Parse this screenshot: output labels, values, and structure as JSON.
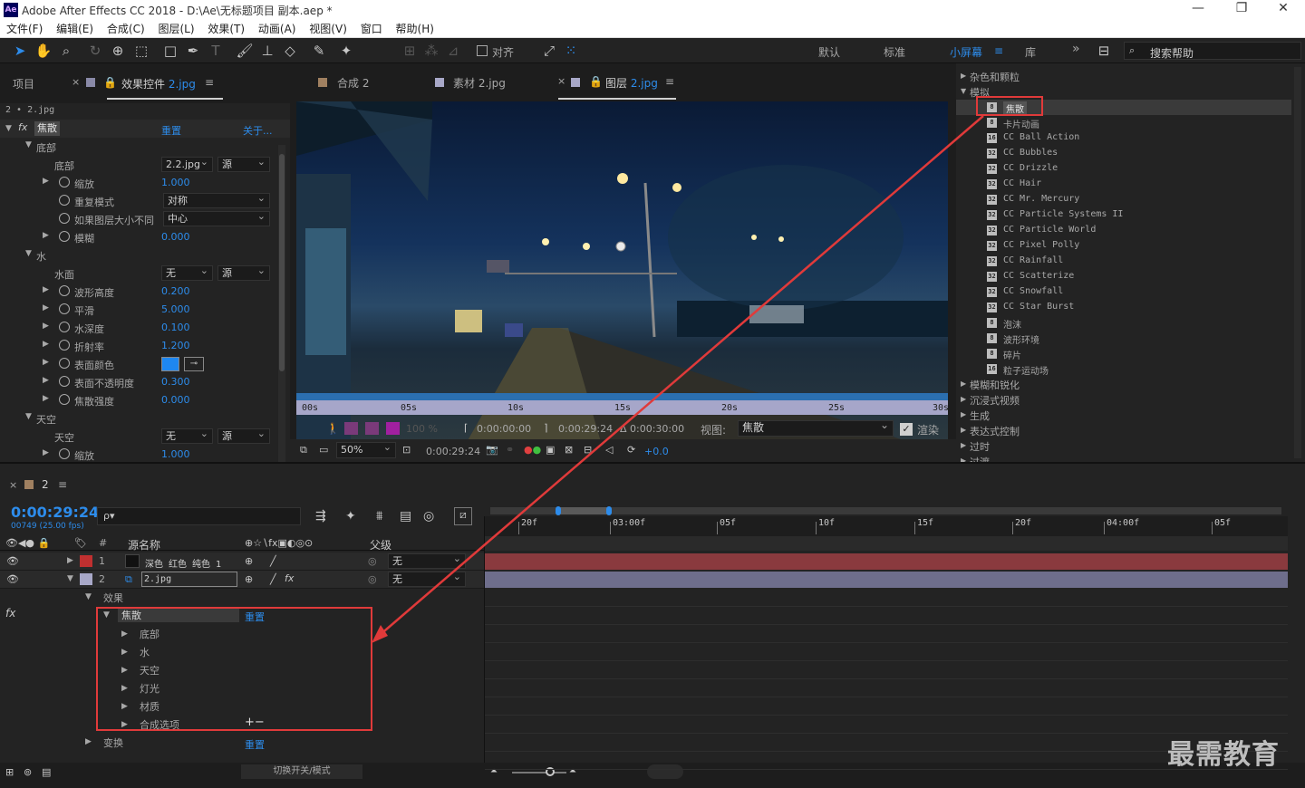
{
  "app": {
    "title": "Adobe After Effects CC 2018 - D:\\Ae\\无标题项目 副本.aep *",
    "logo": "Ae"
  },
  "window_controls": {
    "minimize": "—",
    "restore": "❐",
    "close": "✕"
  },
  "menu": [
    "文件(F)",
    "编辑(E)",
    "合成(C)",
    "图层(L)",
    "效果(T)",
    "动画(A)",
    "视图(V)",
    "窗口",
    "帮助(H)"
  ],
  "toolbar": {
    "snap_label": "对齐",
    "workspaces": [
      "默认",
      "标准",
      "小屏幕",
      "库"
    ],
    "active_workspace": "小屏幕",
    "search_placeholder": "搜索帮助",
    "more": "»"
  },
  "left_panel": {
    "tab_project": "项目",
    "tab_effect": "效果控件",
    "tab_effect_target": "2.jpg",
    "layer_path": "2 • 2.jpg",
    "effect_name": "焦散",
    "reset": "重置",
    "about": "关于...",
    "rows": [
      {
        "t": "group",
        "label": "底部",
        "indent": 1
      },
      {
        "t": "dd2",
        "label": "底部",
        "v1": "2.2.jpg",
        "v2": "源",
        "indent": 2
      },
      {
        "t": "val",
        "label": "缩放",
        "value": "1.000"
      },
      {
        "t": "dd1",
        "label": "重复模式",
        "value": "对称"
      },
      {
        "t": "dd1",
        "label": "如果图层大小不同",
        "value": "中心"
      },
      {
        "t": "val",
        "label": "模糊",
        "value": "0.000"
      },
      {
        "t": "group",
        "label": "水",
        "indent": 1
      },
      {
        "t": "dd2",
        "label": "水面",
        "v1": "无",
        "v2": "源",
        "indent": 2
      },
      {
        "t": "val",
        "label": "波形高度",
        "value": "0.200"
      },
      {
        "t": "val",
        "label": "平滑",
        "value": "5.000"
      },
      {
        "t": "val",
        "label": "水深度",
        "value": "0.100"
      },
      {
        "t": "val",
        "label": "折射率",
        "value": "1.200"
      },
      {
        "t": "color",
        "label": "表面颜色",
        "color": "#1e87f0"
      },
      {
        "t": "val",
        "label": "表面不透明度",
        "value": "0.300"
      },
      {
        "t": "val",
        "label": "焦散强度",
        "value": "0.000"
      },
      {
        "t": "group",
        "label": "天空",
        "indent": 1
      },
      {
        "t": "dd2",
        "label": "天空",
        "v1": "无",
        "v2": "源",
        "indent": 2
      },
      {
        "t": "val",
        "label": "缩放",
        "value": "1.000"
      }
    ]
  },
  "viewer": {
    "tabs": [
      {
        "label": "合成",
        "target": "2",
        "color": "#a08060"
      },
      {
        "label": "素材",
        "target": "2.jpg",
        "color": "#a8a8c8"
      },
      {
        "label": "图层",
        "target": "2.jpg",
        "color": "#a8a8c8",
        "active": true
      }
    ],
    "ruler": [
      "00s",
      "05s",
      "10s",
      "15s",
      "20s",
      "25s",
      "30s"
    ],
    "controls": {
      "opacity": "100 %",
      "in_time": "0:00:00:00",
      "out_time": "0:00:29:24",
      "duration": "Δ 0:00:30:00",
      "view_label": "视图:",
      "view_value": "焦散",
      "render": "渲染"
    },
    "bottom": {
      "zoom": "50%",
      "time": "0:00:29:24",
      "exposure": "+0.0"
    }
  },
  "effects_panel": {
    "items": [
      {
        "t": "cat",
        "label": "杂色和颗粒",
        "open": false
      },
      {
        "t": "cat",
        "label": "模拟",
        "open": true
      },
      {
        "t": "eff",
        "label": "焦散",
        "ic": "8",
        "selected": true
      },
      {
        "t": "eff",
        "label": "卡片动画",
        "ic": "8"
      },
      {
        "t": "eff",
        "label": "CC Ball Action",
        "ic": "16"
      },
      {
        "t": "eff",
        "label": "CC Bubbles",
        "ic": "32"
      },
      {
        "t": "eff",
        "label": "CC Drizzle",
        "ic": "32"
      },
      {
        "t": "eff",
        "label": "CC Hair",
        "ic": "32"
      },
      {
        "t": "eff",
        "label": "CC Mr. Mercury",
        "ic": "32"
      },
      {
        "t": "eff",
        "label": "CC Particle Systems II",
        "ic": "32"
      },
      {
        "t": "eff",
        "label": "CC Particle World",
        "ic": "32"
      },
      {
        "t": "eff",
        "label": "CC Pixel Polly",
        "ic": "32"
      },
      {
        "t": "eff",
        "label": "CC Rainfall",
        "ic": "32"
      },
      {
        "t": "eff",
        "label": "CC Scatterize",
        "ic": "32"
      },
      {
        "t": "eff",
        "label": "CC Snowfall",
        "ic": "32"
      },
      {
        "t": "eff",
        "label": "CC Star Burst",
        "ic": "32"
      },
      {
        "t": "eff",
        "label": "泡沫",
        "ic": "8"
      },
      {
        "t": "eff",
        "label": "波形环境",
        "ic": "8"
      },
      {
        "t": "eff",
        "label": "碎片",
        "ic": "8"
      },
      {
        "t": "eff",
        "label": "粒子运动场",
        "ic": "16"
      },
      {
        "t": "cat",
        "label": "模糊和锐化",
        "open": false
      },
      {
        "t": "cat",
        "label": "沉浸式视频",
        "open": false
      },
      {
        "t": "cat",
        "label": "生成",
        "open": false
      },
      {
        "t": "cat",
        "label": "表达式控制",
        "open": false
      },
      {
        "t": "cat",
        "label": "过时",
        "open": false
      },
      {
        "t": "cat",
        "label": "过渡",
        "open": false
      }
    ]
  },
  "timeline": {
    "tab": "2",
    "timecode": "0:00:29:24",
    "frames": "00749 (25.00 fps)",
    "search_icon": "ρ▾",
    "col_source": "源名称",
    "col_parent": "父级",
    "col_num": "#",
    "ruler": [
      "20f",
      "03:00f",
      "05f",
      "10f",
      "15f",
      "20f",
      "04:00f",
      "05f"
    ],
    "layers": [
      {
        "num": "1",
        "name": "深色 红色 纯色 1",
        "color": "#c03030",
        "parent": "无",
        "bar": "#8a3a3e"
      },
      {
        "num": "2",
        "name": "2.jpg",
        "color": "#a8a8c8",
        "parent": "无",
        "bar": "#6e6e8c"
      }
    ],
    "effects_label": "效果",
    "fx": "fx",
    "effect": "焦散",
    "reset": "重置",
    "subs": [
      "底部",
      "水",
      "天空",
      "灯光",
      "材质",
      "合成选项"
    ],
    "transform": "变换",
    "transform_reset": "重置",
    "toggle_modes": "切换开关/模式",
    "plusminus": "+−"
  },
  "watermark": "最需教育",
  "colors": {
    "accent": "#2d8ceb",
    "highlight_box": "#e03a3a"
  }
}
